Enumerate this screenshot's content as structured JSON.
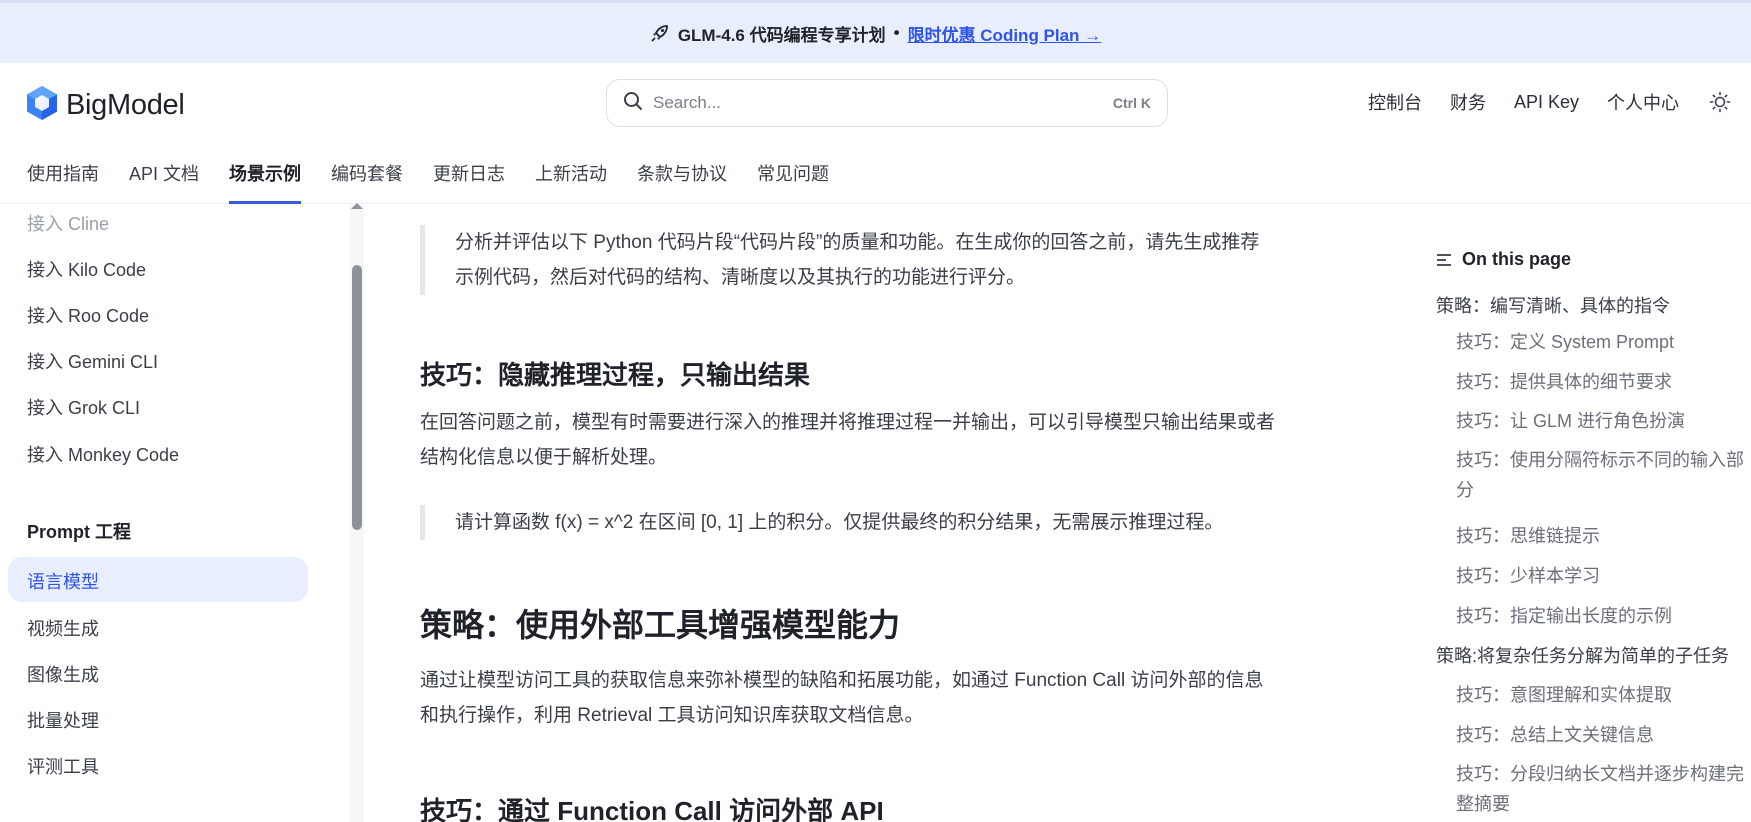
{
  "banner": {
    "icon": "rocket-icon",
    "text": "GLM-4.6 代码编程专享计划",
    "separator": "•",
    "link": "限时优惠 Coding Plan →"
  },
  "header": {
    "logo_text": "BigModel",
    "search_placeholder": "Search...",
    "search_shortcut": "Ctrl K",
    "links": [
      "控制台",
      "财务",
      "API Key",
      "个人中心"
    ],
    "theme_icon": "sun-icon"
  },
  "nav": {
    "tabs": [
      {
        "label": "使用指南",
        "active": false
      },
      {
        "label": "API 文档",
        "active": false
      },
      {
        "label": "场景示例",
        "active": true
      },
      {
        "label": "编码套餐",
        "active": false
      },
      {
        "label": "更新日志",
        "active": false
      },
      {
        "label": "上新活动",
        "active": false
      },
      {
        "label": "条款与协议",
        "active": false
      },
      {
        "label": "常见问题",
        "active": false
      }
    ]
  },
  "sidebar": {
    "items": [
      "接入 Cline",
      "接入 Kilo Code",
      "接入 Roo Code",
      "接入 Gemini CLI",
      "接入 Grok CLI",
      "接入 Monkey Code"
    ],
    "section_title": "Prompt 工程",
    "active_item": "语言模型",
    "section_items": [
      "视频生成",
      "图像生成",
      "批量处理",
      "评测工具"
    ]
  },
  "content": {
    "quote1_line1": "分析并评估以下 Python 代码片段“代码片段”的质量和功能。在生成你的回答之前，请先生成推荐",
    "quote1_line2": "示例代码，然后对代码的结构、清晰度以及其执行的功能进行评分。",
    "h3_hide": "技巧：隐藏推理过程，只输出结果",
    "para_hide_line1": "在回答问题之前，模型有时需要进行深入的推理并将推理过程一并输出，可以引导模型只输出结果或者",
    "para_hide_line2": "结构化信息以便于解析处理。",
    "quote2": "请计算函数 f(x) = x^2 在区间 [0, 1] 上的积分。仅提供最终的积分结果，无需展示推理过程。",
    "h2_tools": "策略：使用外部工具增强模型能力",
    "para_tools_line1": "通过让模型访问工具的获取信息来弥补模型的缺陷和拓展功能，如通过 Function Call 访问外部的信息",
    "para_tools_line2": "和执行操作，利用 Retrieval 工具访问知识库获取文档信息。",
    "h3_function": "技巧：通过 Function Call 访问外部 API"
  },
  "toc": {
    "title": "On this page",
    "entries": [
      {
        "level": 1,
        "text": "策略：编写清晰、具体的指令"
      },
      {
        "level": 2,
        "text": "技巧：定义 System Prompt"
      },
      {
        "level": 2,
        "text": "技巧：提供具体的细节要求"
      },
      {
        "level": 2,
        "text": "技巧：让 GLM 进行角色扮演"
      },
      {
        "level": 2,
        "text": "技巧：使用分隔符标示不同的输入部分"
      },
      {
        "level": 2,
        "text": "技巧：思维链提示"
      },
      {
        "level": 2,
        "text": "技巧：少样本学习"
      },
      {
        "level": 2,
        "text": "技巧：指定输出长度的示例"
      },
      {
        "level": 1,
        "text": "策略:将复杂任务分解为简单的子任务"
      },
      {
        "level": 2,
        "text": "技巧：意图理解和实体提取"
      },
      {
        "level": 2,
        "text": "技巧：总结上文关键信息"
      },
      {
        "level": 2,
        "text": "技巧：分段归纳长文档并逐步构建完整摘要"
      }
    ]
  },
  "colors": {
    "accent": "#2f54eb",
    "banner_bg": "#e9eefc",
    "active_bg": "#e8eeff",
    "tab_underline": "#3b5bdb"
  }
}
